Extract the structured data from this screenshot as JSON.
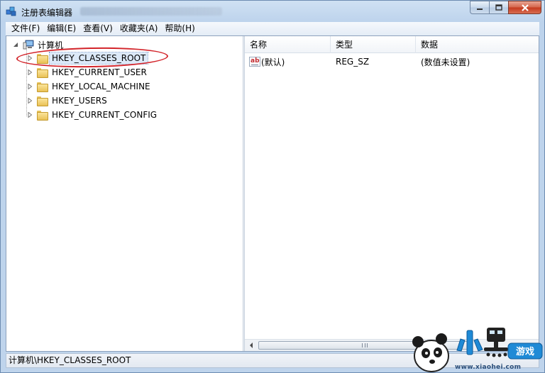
{
  "window": {
    "title": "注册表编辑器",
    "caption_buttons": [
      "minimize-icon",
      "maximize-icon",
      "close-icon"
    ]
  },
  "menubar": {
    "items": [
      "文件(F)",
      "编辑(E)",
      "查看(V)",
      "收藏夹(A)",
      "帮助(H)"
    ]
  },
  "tree": {
    "root_label": "计算机",
    "root_icon": "computer-icon",
    "items": [
      {
        "label": "HKEY_CLASSES_ROOT",
        "icon": "folder-icon",
        "selected": true
      },
      {
        "label": "HKEY_CURRENT_USER",
        "icon": "folder-icon",
        "selected": false
      },
      {
        "label": "HKEY_LOCAL_MACHINE",
        "icon": "folder-icon",
        "selected": false
      },
      {
        "label": "HKEY_USERS",
        "icon": "folder-icon",
        "selected": false
      },
      {
        "label": "HKEY_CURRENT_CONFIG",
        "icon": "folder-icon",
        "selected": false
      }
    ]
  },
  "list": {
    "columns": [
      "名称",
      "类型",
      "数据"
    ],
    "rows": [
      {
        "icon": "string-value-icon",
        "name": "(默认)",
        "type": "REG_SZ",
        "data": "(数值未设置)"
      }
    ],
    "scrollbar_grip": "III"
  },
  "statusbar": {
    "path": "计算机\\HKEY_CLASSES_ROOT"
  },
  "watermark": {
    "brand": "小黑游戏",
    "url": "www.xiaohei.com"
  },
  "colors": {
    "highlight_ellipse": "#d3252b",
    "selection_bg": "#dce9f8",
    "frame": "#bfd4ec"
  }
}
